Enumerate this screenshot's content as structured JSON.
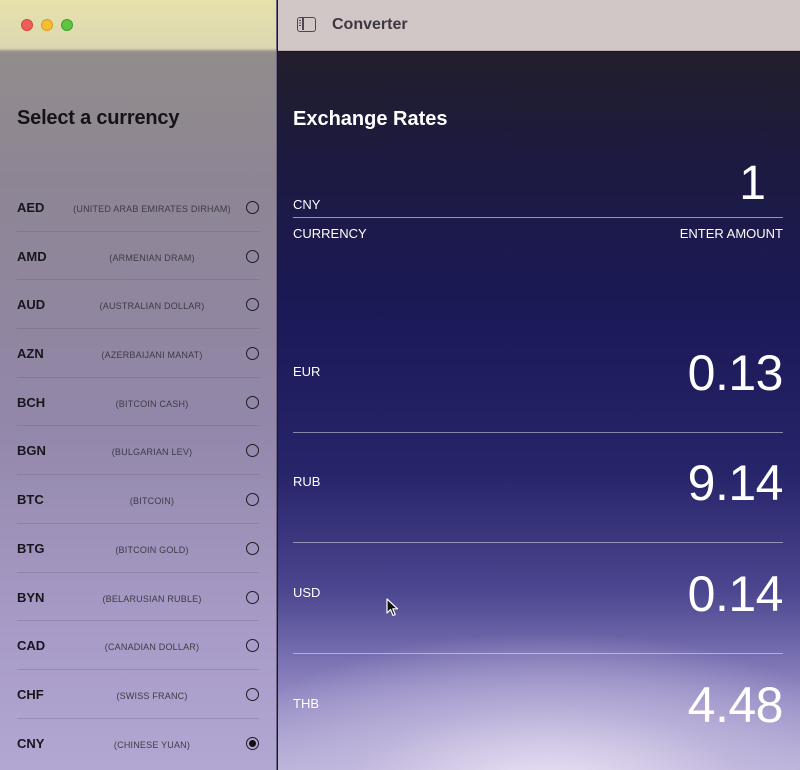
{
  "window": {
    "title": "Converter"
  },
  "sidebar": {
    "title": "Select a currency",
    "currencies": [
      {
        "code": "AED",
        "name": "(UNITED ARAB EMIRATES DIRHAM)",
        "selected": false
      },
      {
        "code": "AMD",
        "name": "(ARMENIAN DRAM)",
        "selected": false
      },
      {
        "code": "AUD",
        "name": "(AUSTRALIAN DOLLAR)",
        "selected": false
      },
      {
        "code": "AZN",
        "name": "(AZERBAIJANI MANAT)",
        "selected": false
      },
      {
        "code": "BCH",
        "name": "(BITCOIN CASH)",
        "selected": false
      },
      {
        "code": "BGN",
        "name": "(BULGARIAN LEV)",
        "selected": false
      },
      {
        "code": "BTC",
        "name": "(BITCOIN)",
        "selected": false
      },
      {
        "code": "BTG",
        "name": "(BITCOIN GOLD)",
        "selected": false
      },
      {
        "code": "BYN",
        "name": "(BELARUSIAN RUBLE)",
        "selected": false
      },
      {
        "code": "CAD",
        "name": "(CANADIAN DOLLAR)",
        "selected": false
      },
      {
        "code": "CHF",
        "name": "(SWISS FRANC)",
        "selected": false
      },
      {
        "code": "CNY",
        "name": "(CHINESE YUAN)",
        "selected": true
      }
    ]
  },
  "main": {
    "title": "Exchange Rates",
    "base": {
      "code": "CNY",
      "amount": "1",
      "currency_label": "CURRENCY",
      "amount_label": "ENTER AMOUNT"
    },
    "rates": [
      {
        "code": "EUR",
        "value": "0.13"
      },
      {
        "code": "RUB",
        "value": "9.14"
      },
      {
        "code": "USD",
        "value": "0.14"
      },
      {
        "code": "THB",
        "value": "4.48"
      }
    ]
  },
  "colors": {
    "close": "#ed5f57",
    "minimize": "#f5bd30",
    "maximize": "#5fc43f"
  }
}
